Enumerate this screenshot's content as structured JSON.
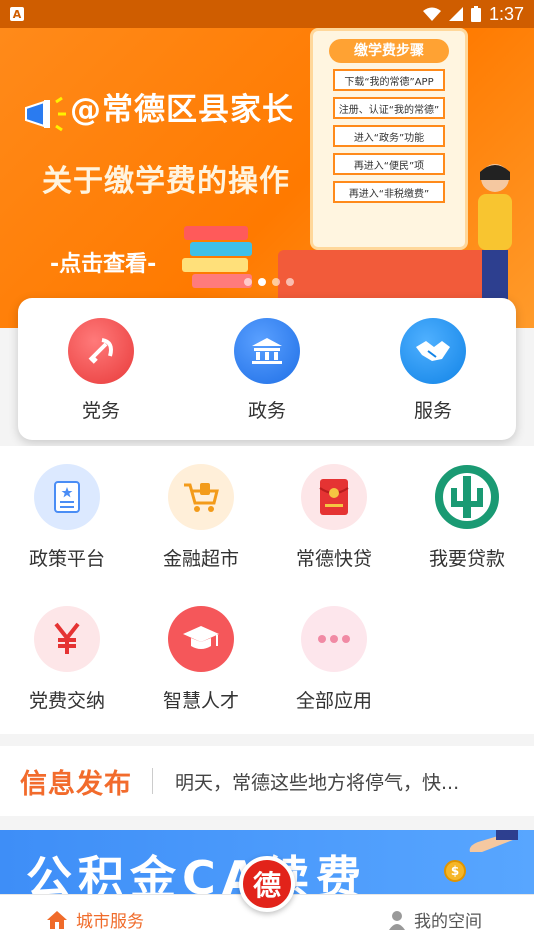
{
  "status_bar": {
    "time": "1:37",
    "left_icon": "A"
  },
  "banner": {
    "title": "@常德区县家长",
    "subtitle": "关于缴学费的操作",
    "cta": "-点击查看-",
    "panel_title": "缴学费步骤",
    "steps": [
      "下载“我的常德”APP",
      "注册、认证“我的常德”",
      "进入“政务”功能",
      "再进入“便民”项",
      "再进入“非税缴费”"
    ],
    "slide_count": 4,
    "active_slide": 1
  },
  "quick": [
    {
      "label": "党务",
      "icon": "party-emblem-icon",
      "color": "#f04444"
    },
    {
      "label": "政务",
      "icon": "building-icon",
      "color": "#2f7ff2"
    },
    {
      "label": "服务",
      "icon": "handshake-icon",
      "color": "#1a8cf0"
    }
  ],
  "apps": [
    {
      "label": "政策平台",
      "icon": "document-star-icon",
      "bg": "#e5f0ff",
      "fg": "#4a8df5"
    },
    {
      "label": "金融超市",
      "icon": "shopping-cart-icon",
      "bg": "#fff1de",
      "fg": "#f39b1a"
    },
    {
      "label": "常德快贷",
      "icon": "red-envelope-icon",
      "bg": "#fde9ea",
      "fg": "#e53333"
    },
    {
      "label": "我要贷款",
      "icon": "bank-logo-icon",
      "bg": "#ffffff",
      "fg": "#1a9a73"
    },
    {
      "label": "党费交纳",
      "icon": "yuan-icon",
      "bg": "#fde9ea",
      "fg": "#e53333"
    },
    {
      "label": "智慧人才",
      "icon": "graduation-cap-icon",
      "bg": "#f5575a",
      "fg": "#ffffff"
    },
    {
      "label": "全部应用",
      "icon": "more-dots-icon",
      "bg": "#fde9ee",
      "fg": "#f18aa4"
    }
  ],
  "news": {
    "tag": "信息发布",
    "text": "明天，常德这些地方将停气，快..."
  },
  "promo": {
    "text": "公积金CA续费",
    "coin": "$"
  },
  "tabbar": {
    "home": "城市服务",
    "center": "德",
    "me": "我的空间"
  },
  "colors": {
    "accent": "#f06b2a",
    "brand_red": "#e2231a"
  }
}
